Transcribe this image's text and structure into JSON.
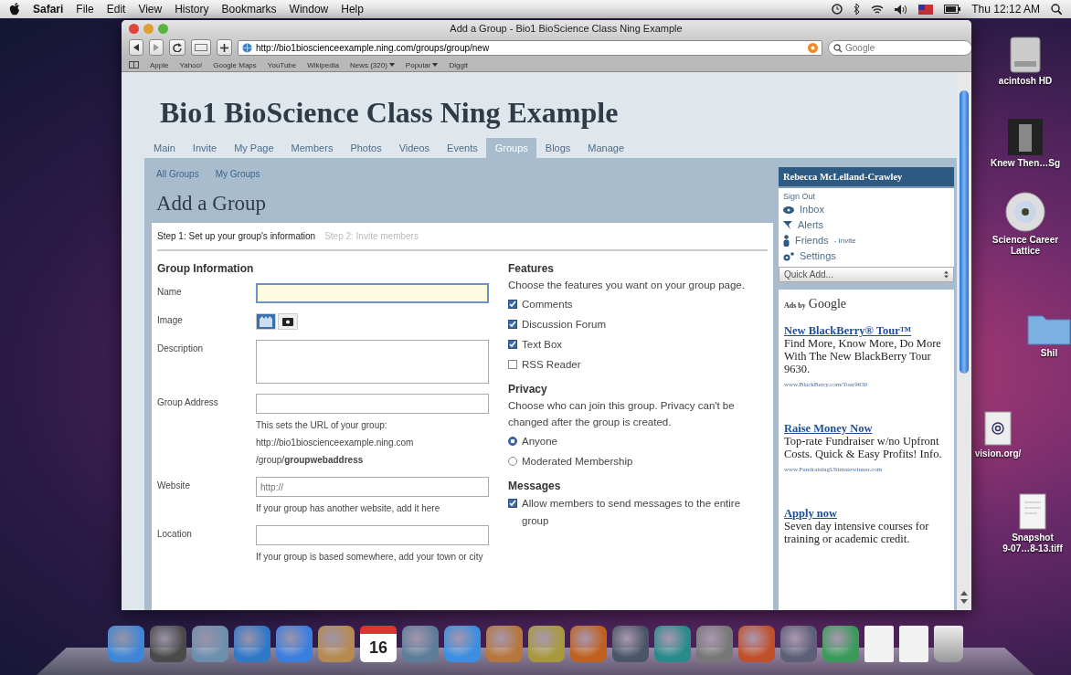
{
  "menu_bar": {
    "app": "Safari",
    "items": [
      "File",
      "Edit",
      "View",
      "History",
      "Bookmarks",
      "Window",
      "Help"
    ],
    "clock": "Thu 12:12 AM"
  },
  "browser": {
    "title": "Add a Group - Bio1 BioScience Class Ning Example",
    "url": "http://bio1bioscienceexample.ning.com/groups/group/new",
    "search_placeholder": "Google",
    "bookmarks": [
      {
        "label": "Apple",
        "menu": false
      },
      {
        "label": "Yahoo!",
        "menu": false
      },
      {
        "label": "Google Maps",
        "menu": false
      },
      {
        "label": "YouTube",
        "menu": false
      },
      {
        "label": "Wikipedia",
        "menu": false
      },
      {
        "label": "News (320)",
        "menu": true
      },
      {
        "label": "Popular",
        "menu": true
      },
      {
        "label": "Diggit",
        "menu": false
      }
    ]
  },
  "site": {
    "title": "Bio1 BioScience Class Ning Example",
    "nav": [
      {
        "label": "Main",
        "selected": false
      },
      {
        "label": "Invite",
        "selected": false
      },
      {
        "label": "My Page",
        "selected": false
      },
      {
        "label": "Members",
        "selected": false
      },
      {
        "label": "Photos",
        "selected": false
      },
      {
        "label": "Videos",
        "selected": false
      },
      {
        "label": "Events",
        "selected": false
      },
      {
        "label": "Groups",
        "selected": true
      },
      {
        "label": "Blogs",
        "selected": false
      },
      {
        "label": "Manage",
        "selected": false
      }
    ],
    "subnav": [
      "All Groups",
      "My Groups"
    ],
    "heading": "Add a Group",
    "steps": [
      {
        "label": "Step 1: Set up your group's information",
        "selected": true
      },
      {
        "label": "Step 2: Invite members",
        "selected": false
      }
    ],
    "group_info": {
      "heading": "Group Information",
      "fields": [
        {
          "kind": "text",
          "label": "Name",
          "focused": true
        },
        {
          "kind": "image",
          "label": "Image",
          "focused": false
        },
        {
          "kind": "textarea",
          "label": "Description",
          "focused": false
        },
        {
          "kind": "text",
          "label": "Group Address",
          "focused": false,
          "help": [
            "This sets the URL of your group:",
            "http://bio1bioscienceexample.ning.com",
            "/group/**groupwebaddress**"
          ]
        },
        {
          "kind": "text",
          "label": "Website",
          "focused": false,
          "placeholder": "http://",
          "help": [
            "If your group has another website, add it here"
          ]
        },
        {
          "kind": "text",
          "label": "Location",
          "focused": false,
          "help": [
            "If your group is based somewhere, add your town or city"
          ]
        }
      ]
    },
    "features": {
      "heading": "Features",
      "description": "Choose the features you want on your group page.",
      "options": [
        {
          "label": "Comments",
          "checked": true
        },
        {
          "label": "Discussion Forum",
          "checked": true
        },
        {
          "label": "Text Box",
          "checked": true
        },
        {
          "label": "RSS Reader",
          "checked": false
        }
      ]
    },
    "privacy": {
      "heading": "Privacy",
      "description": "Choose who can join this group. Privacy can't be changed after the group is created.",
      "options": [
        {
          "label": "Anyone",
          "selected": true
        },
        {
          "label": "Moderated Membership",
          "selected": false
        }
      ]
    },
    "messages": {
      "heading": "Messages",
      "options": [
        {
          "label": "Allow members to send messages to the entire group",
          "checked": true
        }
      ]
    }
  },
  "sidebar": {
    "user": "Rebecca McLelland-Crawley",
    "links": [
      {
        "kind": "plain",
        "label": "Sign Out"
      },
      {
        "kind": "inbox",
        "label": "Inbox"
      },
      {
        "kind": "alerts",
        "label": "Alerts"
      },
      {
        "kind": "friends",
        "label": "Friends",
        "extra": "- Invite"
      },
      {
        "kind": "settings",
        "label": "Settings"
      }
    ],
    "quick_add": "Quick Add...",
    "ads_label": "Ads by",
    "ads_brand": "Google",
    "ads": [
      {
        "title": "New BlackBerry® Tour™",
        "body": "Find More, Know More, Do More With The New BlackBerry Tour 9630.",
        "url": "www.BlackBerry.com/Tour9630"
      },
      {
        "title": "Raise Money Now",
        "body": "Top-rate Fundraiser w/no Upfront Costs. Quick & Easy Profits! Info.",
        "url": "www.FundraisingUltimatewinner.com"
      },
      {
        "title": "Apply now",
        "body": "Seven day intensive courses for training or academic credit."
      }
    ]
  },
  "desktop_icons": [
    {
      "kind": "drive",
      "label": "acintosh HD"
    },
    {
      "kind": "photo",
      "label": "Knew Then…Sg"
    },
    {
      "kind": "disc",
      "label": "Science Career Lattice"
    },
    {
      "kind": "folder",
      "label": "Shil"
    },
    {
      "kind": "webloc",
      "label": "vision.org/"
    },
    {
      "kind": "document",
      "label": "Snapshot",
      "sublabel": "9-07…8-13.tiff"
    }
  ],
  "dock": {
    "calendar_day": "16"
  }
}
